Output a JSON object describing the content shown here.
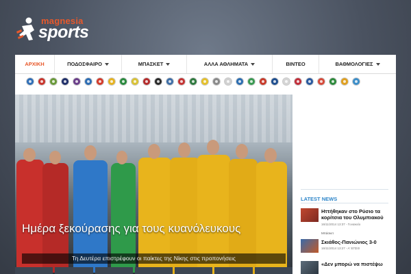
{
  "brand": {
    "top": "magnesia",
    "bottom": "sports",
    "accent_color": "#e8592b"
  },
  "nav": {
    "items": [
      {
        "label": "ΑΡΧΙΚΗ",
        "active": true,
        "dropdown": false
      },
      {
        "label": "ΠΟΔΟΣΦΑΙΡΟ",
        "active": false,
        "dropdown": true
      },
      {
        "label": "ΜΠΑΣΚΕΤ",
        "active": false,
        "dropdown": true
      },
      {
        "label": "ΑΛΛΑ ΑΘΛΗΜΑΤΑ",
        "active": false,
        "dropdown": true
      },
      {
        "label": "ΒΙΝΤΕΟ",
        "active": false,
        "dropdown": false
      },
      {
        "label": "ΒΑΘΜΟΛΟΓΙΕΣ",
        "active": false,
        "dropdown": true
      }
    ]
  },
  "team_badges": [
    {
      "icon": "club-badge-icon",
      "color": "#2f6fb8"
    },
    {
      "icon": "club-badge-icon",
      "color": "#c9342c"
    },
    {
      "icon": "club-badge-icon",
      "color": "#6a9a3a"
    },
    {
      "icon": "club-badge-icon",
      "color": "#1f2f6a"
    },
    {
      "icon": "club-badge-icon",
      "color": "#6b3f8a"
    },
    {
      "icon": "club-badge-icon",
      "color": "#2d6db4"
    },
    {
      "icon": "club-badge-icon",
      "color": "#d43a2a"
    },
    {
      "icon": "club-badge-icon",
      "color": "#e6b321"
    },
    {
      "icon": "club-badge-icon",
      "color": "#2a8a3e"
    },
    {
      "icon": "club-badge-icon",
      "color": "#d9c234"
    },
    {
      "icon": "club-badge-icon",
      "color": "#b52c2c"
    },
    {
      "icon": "club-badge-icon",
      "color": "#2a2a2a"
    },
    {
      "icon": "club-badge-icon",
      "color": "#3f6fa8"
    },
    {
      "icon": "club-badge-icon",
      "color": "#c43434"
    },
    {
      "icon": "club-badge-icon",
      "color": "#2f7a3f"
    },
    {
      "icon": "club-badge-icon",
      "color": "#e5c02a"
    },
    {
      "icon": "club-badge-icon",
      "color": "#8a8a8a"
    },
    {
      "icon": "club-badge-icon",
      "color": "#d0d0d0"
    },
    {
      "icon": "club-badge-icon",
      "color": "#2c6eb2"
    },
    {
      "icon": "club-badge-icon",
      "color": "#3a9a52"
    },
    {
      "icon": "club-badge-icon",
      "color": "#c83a2a"
    },
    {
      "icon": "club-badge-icon",
      "color": "#1f4f8f"
    },
    {
      "icon": "club-badge-icon",
      "color": "#d5d5d5"
    },
    {
      "icon": "club-badge-icon",
      "color": "#c12e3a"
    },
    {
      "icon": "club-badge-icon",
      "color": "#2a5aa0"
    },
    {
      "icon": "club-badge-icon",
      "color": "#d64a3a"
    },
    {
      "icon": "club-badge-icon",
      "color": "#2d8a3c"
    },
    {
      "icon": "club-badge-icon",
      "color": "#e0a020"
    },
    {
      "icon": "club-badge-icon",
      "color": "#3c8ec9"
    }
  ],
  "hero": {
    "title": "Ημέρα ξεκούρασης για τους κυανόλευκους",
    "subtitle": "Τη Δευτέρα επιστρέφουν οι παίκτες της Νίκης στις προπονήσεις"
  },
  "latest_news": {
    "title": "LATEST NEWS",
    "items": [
      {
        "headline": "Ηττήθηκαν στο Ρύσιο τα κορίτσια του Ολυμπιακού",
        "meta": "16/11/2014 13:37 - Γυναικείο",
        "category": "Μπάσκετ"
      },
      {
        "headline": "Σκιάθος-Πανιώνιος 3-0",
        "meta": "16/11/2014 13:27 - Α' ΕΠΣΘ",
        "category": ""
      },
      {
        "headline": "«Δεν μπορώ να πιστέψω",
        "meta": "",
        "category": ""
      }
    ]
  }
}
